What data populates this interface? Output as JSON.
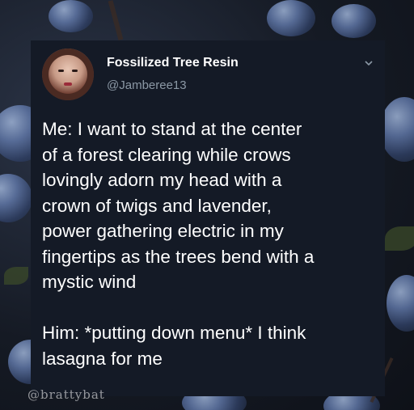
{
  "profile": {
    "name": "Fossilized Tree Resin",
    "handle": "@Jamberee13"
  },
  "tweet": {
    "lines": [
      "Me: I want to stand at the center",
      "of a forest clearing while crows",
      "lovingly adorn my head with a",
      "crown of twigs and lavender,",
      "power gathering electric in my",
      "fingertips as the trees bend with a",
      "mystic wind",
      "",
      "Him: *putting down menu* I think",
      "lasagna for me"
    ]
  },
  "watermark": "@brattybat",
  "icons": {
    "menu": "chevron-down-icon",
    "avatar": "profile-avatar"
  },
  "colors": {
    "card_bg": "#141a26",
    "text": "#ffffff",
    "muted": "#8b98a5"
  }
}
